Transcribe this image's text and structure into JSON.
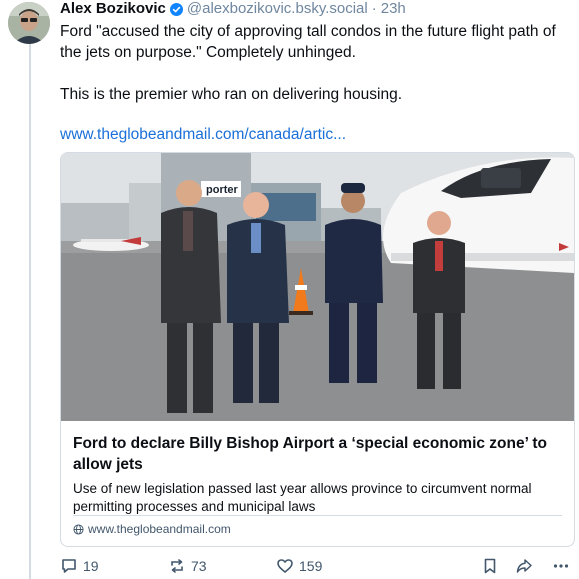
{
  "post": {
    "author_name": "Alex Bozikovic",
    "handle": "@alexbozikovic.bsky.social",
    "separator": "·",
    "time": "23h",
    "text_line1": "Ford \"accused the city of approving tall condos in the future flight path of the jets on purpose.\" Completely unhinged.",
    "text_line2": "This is the premier who ran on delivering housing.",
    "link": "www.theglobeandmail.com/canada/artic..."
  },
  "card": {
    "title": "Ford to declare Billy Bishop Airport a ‘special economic zone’ to allow jets",
    "description": "Use of new legislation passed last year allows province to circumvent normal permitting processes and municipal laws",
    "source": "www.theglobeandmail.com",
    "building_sign": "porter"
  },
  "actions": {
    "replies": "19",
    "reposts": "73",
    "likes": "159"
  },
  "colors": {
    "link": "#1a6fd8",
    "verified": "#1185fe",
    "muted": "#6f869f",
    "border": "#d4dbe2"
  }
}
